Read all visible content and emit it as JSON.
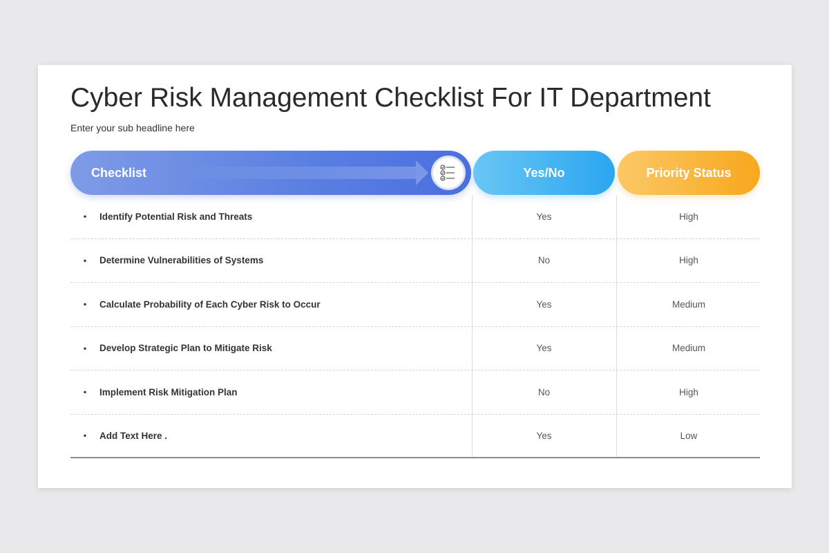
{
  "header": {
    "title": "Cyber Risk Management Checklist For IT Department",
    "subtitle": "Enter your sub headline here"
  },
  "columns": {
    "checklist": "Checklist",
    "yes_no": "Yes/No",
    "priority": "Priority Status"
  },
  "icons": {
    "checklist_icon": "checklist-icon",
    "arrow": "arrow-right-icon"
  },
  "colors": {
    "checklist_pill": "#5a7fe2",
    "yesno_pill": "#2aa6f0",
    "priority_pill": "#f8a81c"
  },
  "rows": [
    {
      "bullet": "•",
      "item": "Identify Potential Risk and Threats",
      "yes_no": "Yes",
      "priority": "High"
    },
    {
      "bullet": "•",
      "item": "Determine Vulnerabilities of Systems",
      "yes_no": "No",
      "priority": "High"
    },
    {
      "bullet": "•",
      "item": "Calculate Probability of Each Cyber Risk to Occur",
      "yes_no": "Yes",
      "priority": "Medium"
    },
    {
      "bullet": "•",
      "item": "Develop Strategic Plan to Mitigate Risk",
      "yes_no": "Yes",
      "priority": "Medium"
    },
    {
      "bullet": "•",
      "item": "Implement Risk Mitigation Plan",
      "yes_no": "No",
      "priority": "High"
    },
    {
      "bullet": "•",
      "item": "Add Text Here .",
      "yes_no": "Yes",
      "priority": "Low"
    }
  ]
}
